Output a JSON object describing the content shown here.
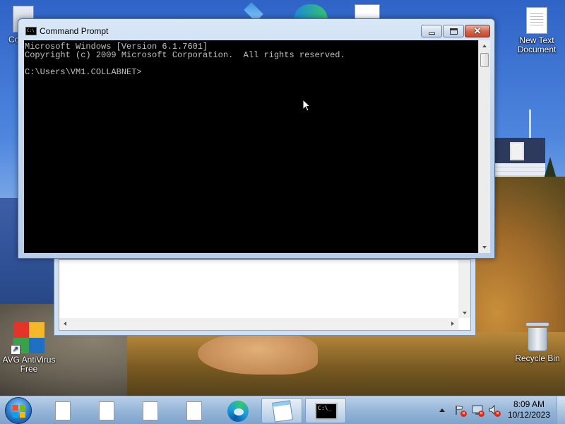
{
  "desktop": {
    "icons": {
      "computer_partial": "Co",
      "new_text_document": "New Text\nDocument",
      "avg": "AVG AntiVirus\nFree",
      "recycle_bin": "Recycle Bin"
    }
  },
  "cmd_window": {
    "title": "Command Prompt",
    "icon": "cmd-icon",
    "console_text": "Microsoft Windows [Version 6.1.7601]\nCopyright (c) 2009 Microsoft Corporation.  All rights reserved.\n\nC:\\Users\\VM1.COLLABNET>",
    "buttons": {
      "minimize": "minimize-icon",
      "maximize": "maximize-icon",
      "close": "close-icon",
      "close_glyph": "✕"
    }
  },
  "taskbar": {
    "start_icon": "windows-start-icon",
    "items": [
      {
        "icon": "document-icon"
      },
      {
        "icon": "document-icon"
      },
      {
        "icon": "document-icon"
      },
      {
        "icon": "document-icon"
      },
      {
        "icon": "edge-icon"
      },
      {
        "icon": "notepad-icon"
      },
      {
        "icon": "command-prompt-icon"
      }
    ],
    "cmd_glyph": "C:\\_",
    "tray": {
      "icons": [
        "show-hidden-icons",
        "action-center-flag-icon",
        "network-icon",
        "volume-muted-icon"
      ],
      "time": "8:09 AM",
      "date": "10/12/2023"
    }
  },
  "colors": {
    "console_bg": "#000000",
    "console_text": "#c0c0c0",
    "close_button": "#c4472c"
  }
}
